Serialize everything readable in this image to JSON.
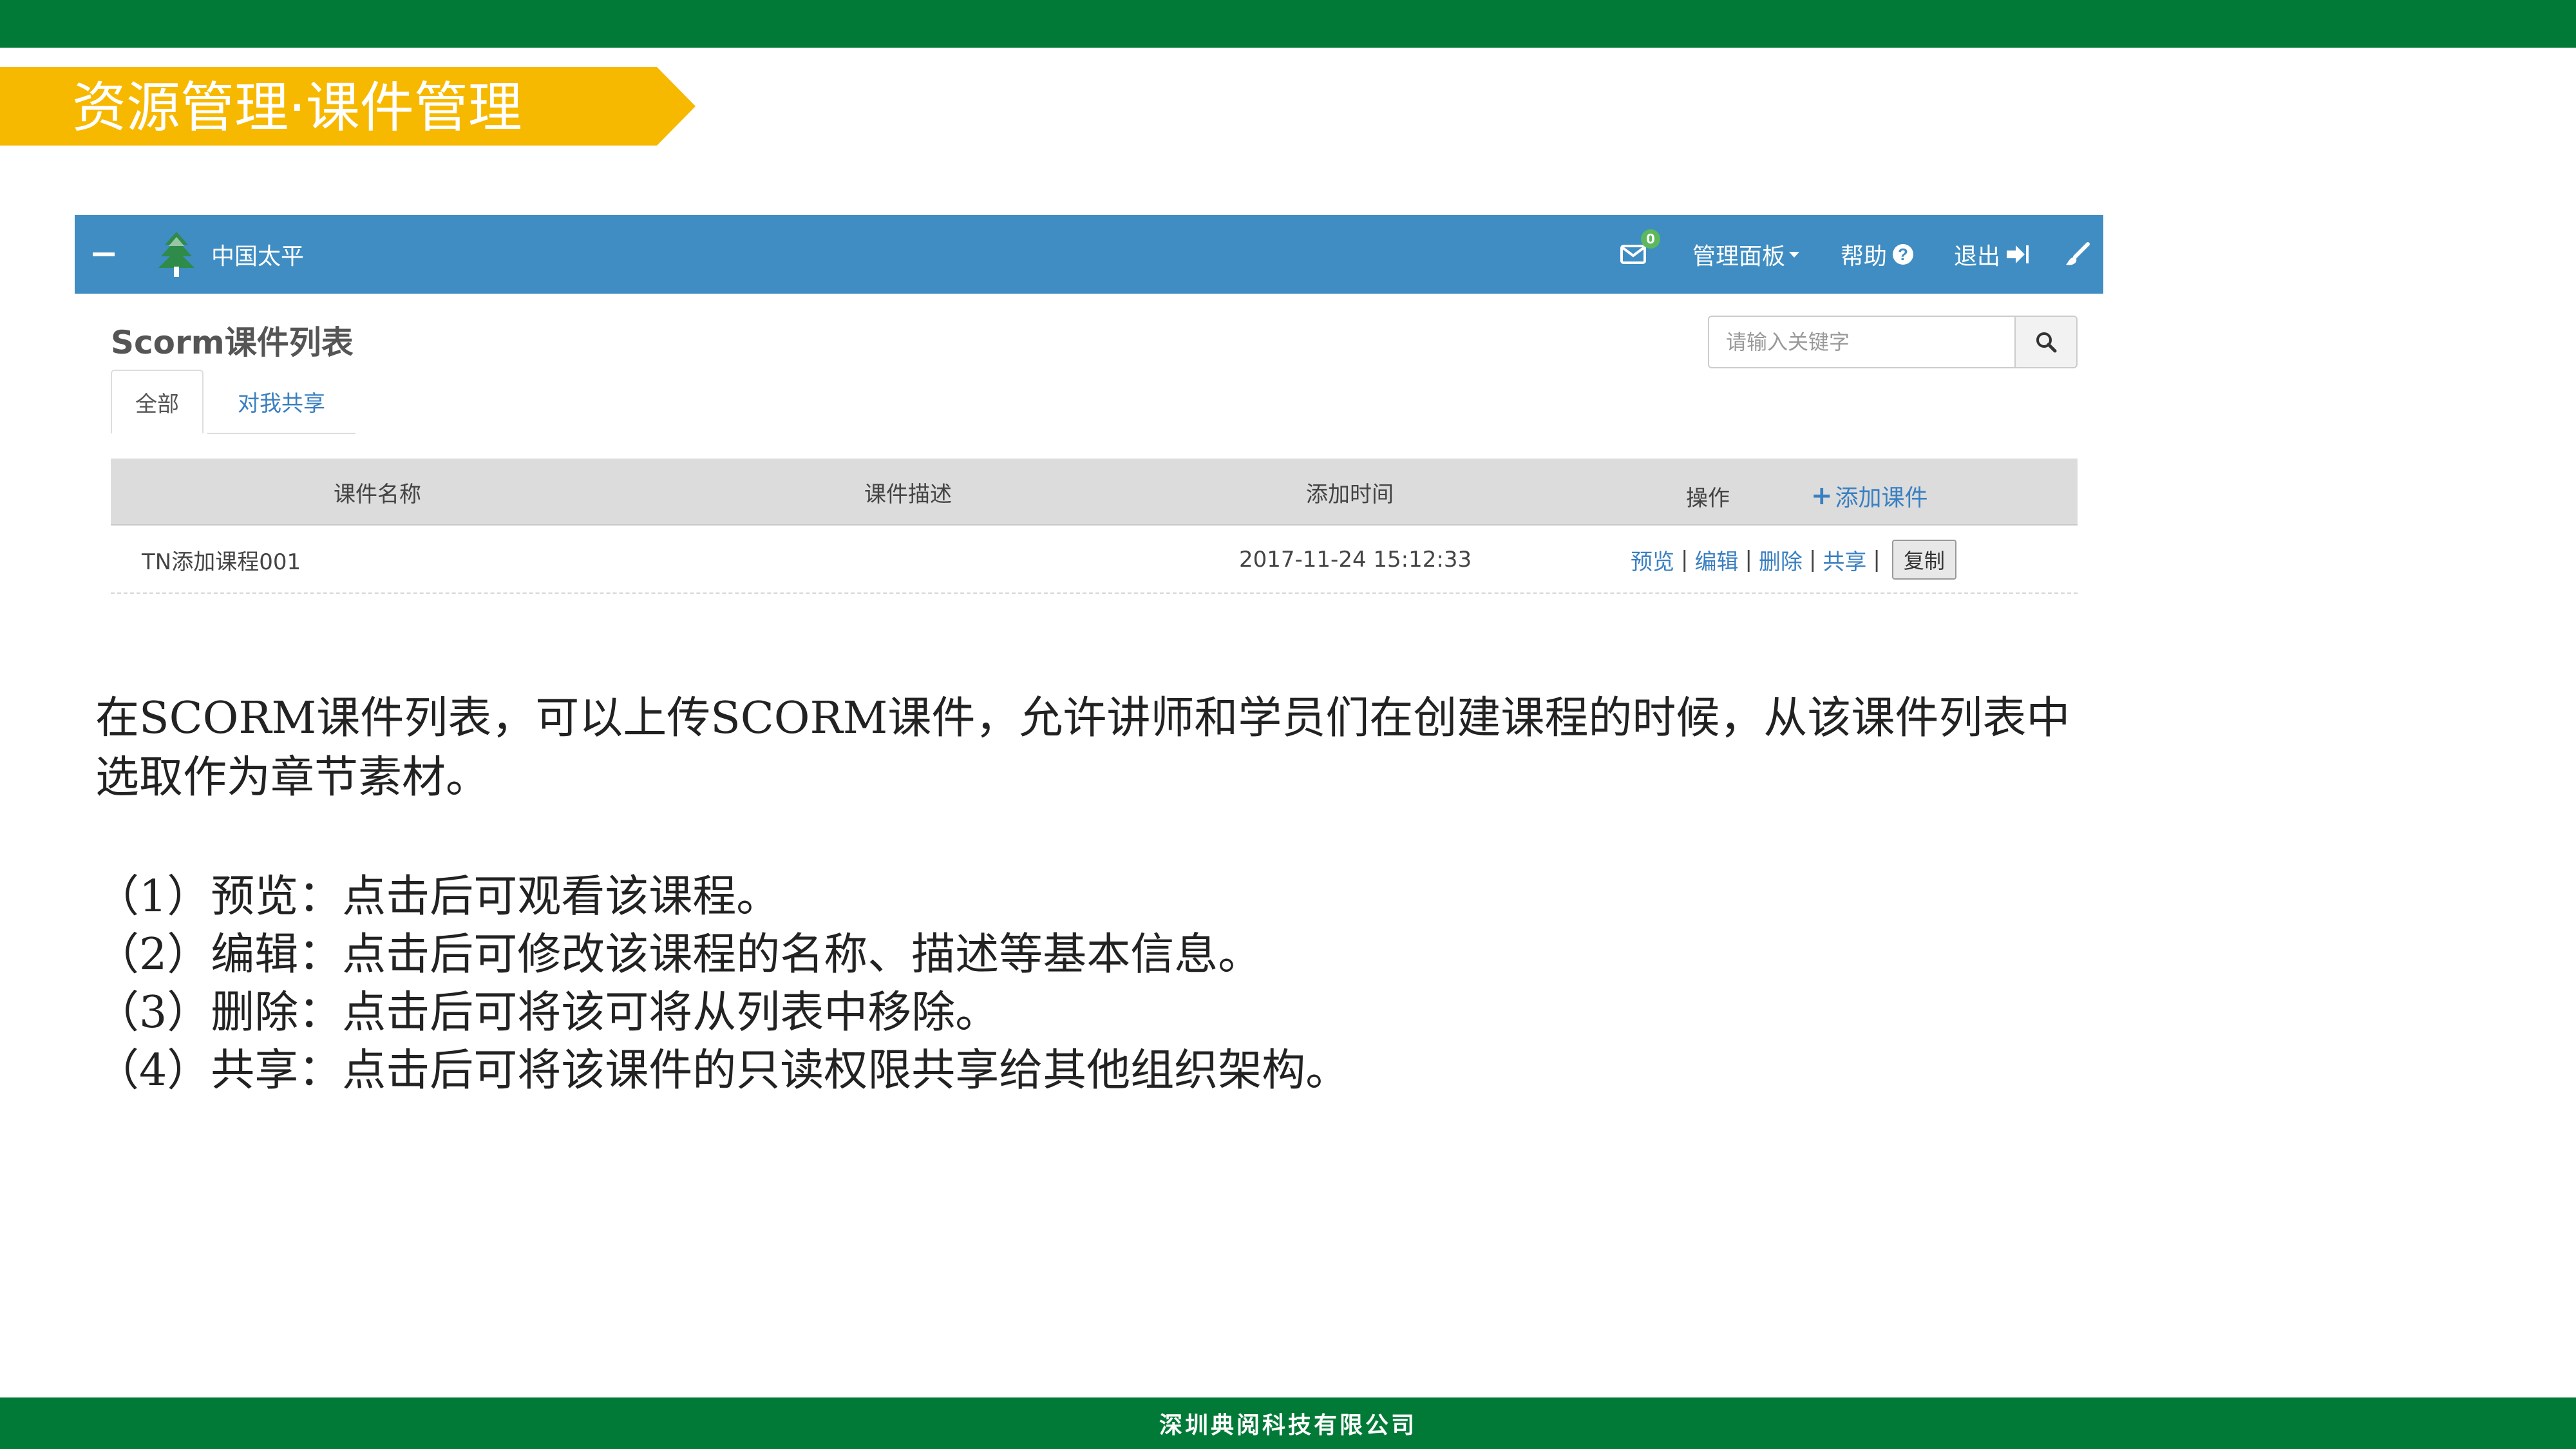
{
  "slide": {
    "title": "资源管理·课件管理",
    "footer": "深圳典阅科技有限公司",
    "colors": {
      "band": "#007a36",
      "banner": "#f7b800",
      "navbar": "#3f8dc2",
      "link": "#3a7fc1"
    }
  },
  "app": {
    "brand": "中国太平",
    "nav": {
      "mail_badge": "0",
      "panel_label": "管理面板",
      "help_label": "帮助",
      "logout_label": "退出",
      "icons": [
        "menu-icon",
        "tree-logo-icon",
        "mail-icon",
        "question-icon",
        "sign-out-icon",
        "brush-icon"
      ]
    },
    "page_title": "Scorm课件列表",
    "search": {
      "placeholder": "请输入关键字",
      "value": ""
    },
    "tabs": [
      {
        "label": "全部",
        "active": true
      },
      {
        "label": "对我共享",
        "active": false
      }
    ],
    "table": {
      "headers": {
        "name": "课件名称",
        "desc": "课件描述",
        "time": "添加时间",
        "op": "操作",
        "add": "添加课件"
      },
      "rows": [
        {
          "name": "TN添加课程001",
          "desc": "",
          "time": "2017-11-24 15:12:33",
          "actions": {
            "preview": "预览",
            "edit": "编辑",
            "delete": "删除",
            "share": "共享",
            "copy": "复制"
          }
        }
      ]
    }
  },
  "description": {
    "intro": "在SCORM课件列表，可以上传SCORM课件，允许讲师和学员们在创建课程的时候，从该课件列表中选取作为章节素材。",
    "items": [
      "（1）预览：点击后可观看该课程。",
      "（2）编辑：点击后可修改该课程的名称、描述等基本信息。",
      "（3）删除：点击后可将该可将从列表中移除。",
      "（4）共享：点击后可将该课件的只读权限共享给其他组织架构。"
    ]
  }
}
